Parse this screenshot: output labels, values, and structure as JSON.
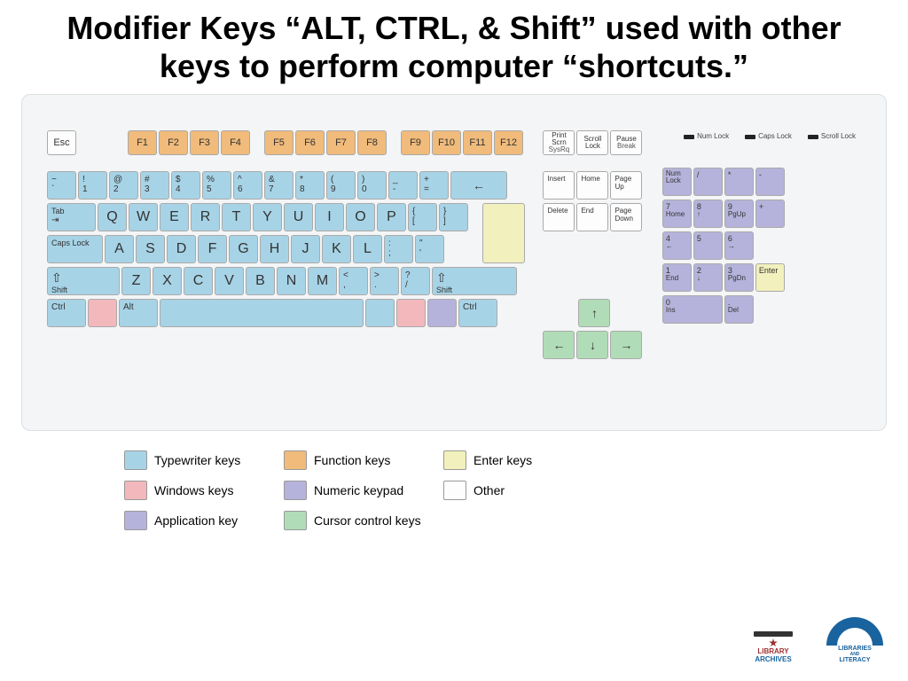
{
  "title": "Modifier Keys “ALT, CTRL, & Shift” used with other keys to perform computer “shortcuts.”",
  "colors": {
    "typewriter": "#a7d3e6",
    "function": "#f0bb7b",
    "enter": "#f2f0bc",
    "windows": "#f2b8bc",
    "application": "#b5b3db",
    "numeric": "#b5b3db",
    "cursor": "#b0dcb7",
    "other": "#fdfdfd"
  },
  "func": [
    "F1",
    "F2",
    "F3",
    "F4",
    "F5",
    "F6",
    "F7",
    "F8",
    "F9",
    "F10",
    "F11",
    "F12"
  ],
  "esc": "Esc",
  "numrow": [
    {
      "t": "~",
      "b": "`"
    },
    {
      "t": "!",
      "b": "1"
    },
    {
      "t": "@",
      "b": "2"
    },
    {
      "t": "#",
      "b": "3"
    },
    {
      "t": "$",
      "b": "4"
    },
    {
      "t": "%",
      "b": "5"
    },
    {
      "t": "^",
      "b": "6"
    },
    {
      "t": "&",
      "b": "7"
    },
    {
      "t": "*",
      "b": "8"
    },
    {
      "t": "(",
      "b": "9"
    },
    {
      "t": ")",
      "b": "0"
    },
    {
      "t": "_",
      "b": "-"
    },
    {
      "t": "+",
      "b": "="
    }
  ],
  "backspace": "←",
  "tab": "Tab",
  "qrow": [
    "Q",
    "W",
    "E",
    "R",
    "T",
    "Y",
    "U",
    "I",
    "O",
    "P"
  ],
  "bracket1": {
    "t": "{",
    "b": "["
  },
  "bracket2": {
    "t": "}",
    "b": "]"
  },
  "caps": "Caps Lock",
  "arow": [
    "A",
    "S",
    "D",
    "F",
    "G",
    "H",
    "J",
    "K",
    "L"
  ],
  "semi": {
    "t": ":",
    "b": ";"
  },
  "quote": {
    "t": "\"",
    "b": "'"
  },
  "shift": "Shift",
  "zrow": [
    "Z",
    "X",
    "C",
    "V",
    "B",
    "N",
    "M"
  ],
  "comma": {
    "t": "<",
    "b": ","
  },
  "period": {
    "t": ">",
    "b": "."
  },
  "slash": {
    "t": "?",
    "b": "/"
  },
  "ctrl": "Ctrl",
  "alt": "Alt",
  "sys": [
    {
      "a": "Print",
      "b": "Scrn",
      "c": "SysRq"
    },
    {
      "a": "Scroll",
      "b": "Lock",
      "c": ""
    },
    {
      "a": "Pause",
      "b": "",
      "c": "Break"
    }
  ],
  "nav": [
    {
      "l": "Insert"
    },
    {
      "l": "Home"
    },
    {
      "l": "Page Up"
    },
    {
      "l": "Delete"
    },
    {
      "l": "End"
    },
    {
      "l": "Page Down"
    }
  ],
  "arrows": {
    "up": "↑",
    "down": "↓",
    "left": "←",
    "right": "→"
  },
  "leds": [
    "Num Lock",
    "Caps Lock",
    "Scroll Lock"
  ],
  "numpad": {
    "numlock": "Num Lock",
    "div": "/",
    "mul": "*",
    "sub": "-",
    "7": {
      "n": "7",
      "l": "Home"
    },
    "8": {
      "n": "8",
      "l": "↑"
    },
    "9": {
      "n": "9",
      "l": "PgUp"
    },
    "4": {
      "n": "4",
      "l": "←"
    },
    "5": {
      "n": "5",
      "l": ""
    },
    "6": {
      "n": "6",
      "l": "→"
    },
    "1": {
      "n": "1",
      "l": "End"
    },
    "2": {
      "n": "2",
      "l": "↓"
    },
    "3": {
      "n": "3",
      "l": "PgDn"
    },
    "0": {
      "n": "0",
      "l": "Ins"
    },
    "dot": {
      "n": ".",
      "l": "Del"
    },
    "plus": "+",
    "enter": "Enter"
  },
  "legend": [
    {
      "c": "typewriter",
      "t": "Typewriter keys"
    },
    {
      "c": "function",
      "t": "Function keys"
    },
    {
      "c": "enter",
      "t": "Enter keys"
    },
    {
      "c": "windows",
      "t": "Windows keys"
    },
    {
      "c": "numeric",
      "t": "Numeric keypad"
    },
    {
      "c": "other",
      "t": "Other"
    },
    {
      "c": "application",
      "t": "Application key"
    },
    {
      "c": "cursor",
      "t": "Cursor control keys"
    }
  ],
  "logo1": {
    "line1": "LIBRARY",
    "line2": "ARCHIVES"
  },
  "logo2": {
    "line1": "LIBRARIES",
    "line2": "AND",
    "line3": "LITERACY"
  }
}
